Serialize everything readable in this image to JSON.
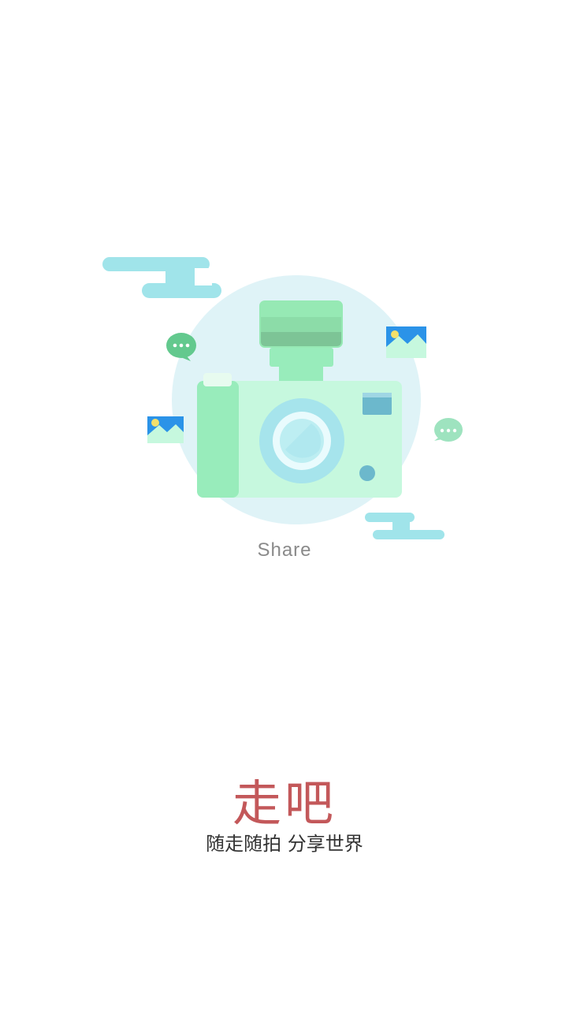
{
  "splash": {
    "caption": "Share",
    "title": "走吧",
    "slogan": "随走随拍 分享世界"
  },
  "colors": {
    "background": "#ffffff",
    "title": "#c3585a",
    "slogan": "#333333",
    "caption": "#8a8a8a",
    "cloud": "#a0e4ea",
    "circle": "#dff3f7",
    "camera_body": "#c6f8de",
    "camera_grip": "#98ecbb",
    "lens_ring": "#a6e4ec",
    "bubble": "#63c98e",
    "photo_sky": "#2b93e8"
  },
  "icons": [
    "camera-icon",
    "cloud-icon",
    "chat-bubble-icon",
    "image-icon"
  ]
}
